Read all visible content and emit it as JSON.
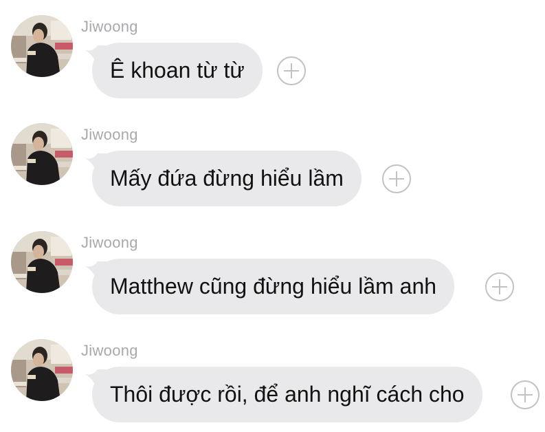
{
  "messages": [
    {
      "sender": "Jiwoong",
      "text": "Ê khoan từ từ",
      "avatar_icon": "profile-photo"
    },
    {
      "sender": "Jiwoong",
      "text": "Mấy đứa đừng hiểu lầm",
      "avatar_icon": "profile-photo"
    },
    {
      "sender": "Jiwoong",
      "text": "Matthew cũng đừng hiểu lầm anh",
      "avatar_icon": "profile-photo"
    },
    {
      "sender": "Jiwoong",
      "text": "Thôi được rồi, để anh nghĩ cách cho",
      "avatar_icon": "profile-photo"
    }
  ],
  "reaction_icon": "plus-circle-icon",
  "colors": {
    "bubble": "#e9e9eb",
    "sender": "#a8a8ad",
    "text": "#111111",
    "plus": "#c2c2c6"
  }
}
